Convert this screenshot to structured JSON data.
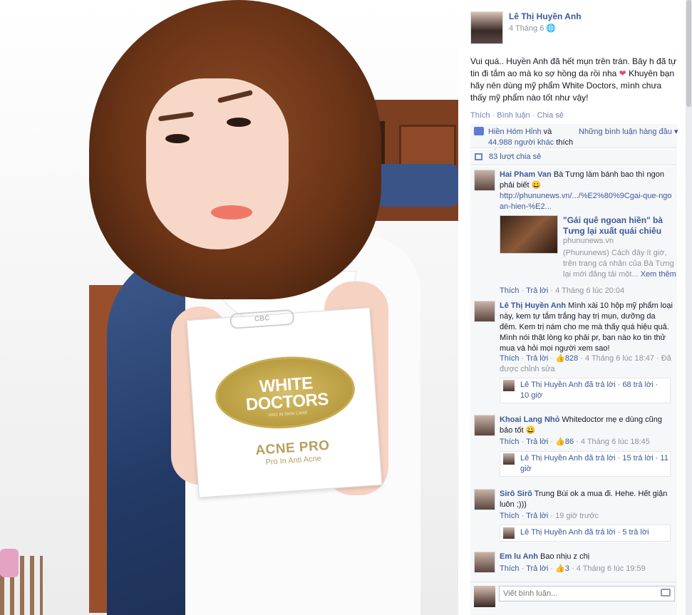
{
  "photo": {
    "box_top_label": "CBC",
    "brand_line1": "WHITE",
    "brand_line2": "DOCTORS",
    "brand_sub": "PRO IN SKIN CARE",
    "product": "ACNE PRO",
    "product_sub": "Pro In Anti Acne"
  },
  "post": {
    "author": "Lê Thị Huyền Anh",
    "date": "4 Tháng 6",
    "text": "Vui quá.. Huyền Anh đã hết mụn trên trán. Bây h đã tự tin đi tắm ao mà ko sợ hồng da rồi nha",
    "text_after": " Khuyên bạn hãy nên dùng mỹ phẩm White Doctors, mình chưa thấy mỹ phẩm nào tốt như vậy!",
    "actions": {
      "like": "Thích",
      "comment": "Bình luận",
      "share": "Chia sẻ",
      "separator": " · "
    },
    "likes": {
      "name": "Hiền Hóm Hỉnh",
      "and": " và ",
      "others": "44.988 người khác",
      "suffix": " thích điều này."
    },
    "order": "Những bình luận hàng đầu ▾",
    "shares": "83 lượt chia sẻ"
  },
  "comments": [
    {
      "name": "Hai Pham Van",
      "text": " Bà Tưng làm bánh bao thì ngon phải biết 😀",
      "link": "http://phununews.vn/.../%E2%80%9Cgai-que-ngoan-hien-%E2...",
      "preview_title": "\"Gái quê ngoan hiền\" bà Tưng lại xuất quái chiêu",
      "preview_domain": "phununews.vn",
      "preview_desc": "(Phununews) Cách đây ít giờ, trên trang cá nhân của Bà Tưng lại mới đăng tải một...",
      "preview_more": " Xem thêm",
      "meta_like": "Thích",
      "meta_reply": "Trả lời",
      "meta_time": "4 Tháng 6 lúc 20:04"
    },
    {
      "name": "Lê Thị Huyền Anh",
      "text": " Mình xài 10 hộp mỹ phẩm loại này, kem tự tắm trắng hay trị mụn, dưỡng da đêm. Kem trị nám cho mẹ mà thấy quá hiệu quả. Mình nói thật lòng ko phải pr, bạn nào ko tin thử mua và hỏi mọi người xem sao!",
      "meta_like": "Thích",
      "meta_reply": "Trả lời",
      "meta_count": "828",
      "meta_time": "4 Tháng 6 lúc 18:47",
      "meta_edited": "Đã được chỉnh sửa",
      "replies": "Lê Thị Huyền Anh đã trả lời · 68 trả lời · 10 giờ"
    },
    {
      "name": "Khoai Lang Nhỏ",
      "text": " Whitedoctor mẹ e dùng cũng bảo tốt 😀",
      "meta_like": "Thích",
      "meta_reply": "Trả lời",
      "meta_count": "86",
      "meta_time": "4 Tháng 6 lúc 18:45",
      "replies": "Lê Thị Huyền Anh đã trả lời · 15 trả lời · 11 giờ"
    },
    {
      "name": "Sirô Sirô",
      "text": " Trung Bùi ok a mua đi. Hehe. Hết giận luôn ;)))",
      "meta_like": "Thích",
      "meta_reply": "Trả lời",
      "meta_time": "19 giờ trước",
      "replies": "Lê Thị Huyền Anh đã trả lời · 5 trả lời"
    },
    {
      "name": "Em lu Anh",
      "text": " Bao nhịu z chị",
      "meta_like": "Thích",
      "meta_reply": "Trả lời",
      "meta_count": "3",
      "meta_time": "4 Tháng 6 lúc 19:59"
    }
  ],
  "write": {
    "placeholder": "Viết bình luận..."
  },
  "colors": {
    "link": "#3b5998",
    "muted": "#90949c",
    "panel": "#f6f7f9"
  }
}
